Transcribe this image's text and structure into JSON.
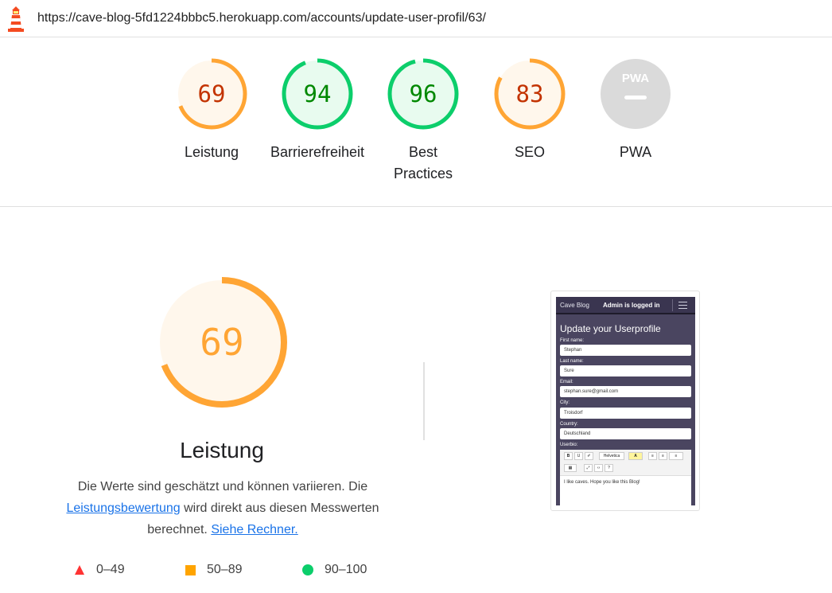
{
  "url": "https://cave-blog-5fd1224bbbc5.herokuapp.com/accounts/update-user-profil/63/",
  "colors": {
    "orange": "#ffa534",
    "orange_text": "#c33300",
    "orange_bg": "#fff7ec",
    "green": "#0cce6b",
    "green_text": "#008800",
    "green_bg": "#e8fbef",
    "red": "#ff3333",
    "gray": "#dadada"
  },
  "gauges": [
    {
      "score": "69",
      "label": "Leistung",
      "level": 0.69,
      "status": "average"
    },
    {
      "score": "94",
      "label": "Barrierefreiheit",
      "level": 0.94,
      "status": "pass"
    },
    {
      "score": "96",
      "label": "Best Practices",
      "level": 0.96,
      "status": "pass"
    },
    {
      "score": "83",
      "label": "SEO",
      "level": 0.83,
      "status": "average"
    },
    {
      "score": "",
      "label": "PWA",
      "badge": "PWA",
      "status": "na"
    }
  ],
  "main": {
    "score": "69",
    "level": 0.69,
    "title": "Leistung",
    "desc_part1": "Die Werte sind geschätzt und können variieren. Die ",
    "desc_link1": "Leistungsbewertung",
    "desc_part2": " wird direkt aus diesen Messwerten berechnet. ",
    "desc_link2": "Siehe Rechner."
  },
  "legend": [
    {
      "range": "0–49",
      "shape": "triangle",
      "color": "#ff3333"
    },
    {
      "range": "50–89",
      "shape": "square",
      "color": "#ffa400"
    },
    {
      "range": "90–100",
      "shape": "circle",
      "color": "#0cce6b"
    }
  ],
  "thumbnail": {
    "brand": "Cave Blog",
    "login": "Admin is logged in",
    "heading": "Update your Userprofile",
    "fields": [
      {
        "label": "First name:",
        "value": "Stephan"
      },
      {
        "label": "Last name:",
        "value": "Sure"
      },
      {
        "label": "Email:",
        "value": "stephan.sure@gmail.com"
      },
      {
        "label": "City:",
        "value": "Troisdorf"
      },
      {
        "label": "Country:",
        "value": "Deutschland"
      }
    ],
    "userbio_label": "Userbio:",
    "font_select": "Helvetica",
    "editor_text": "I like caves. Hope you like this Blog!"
  }
}
